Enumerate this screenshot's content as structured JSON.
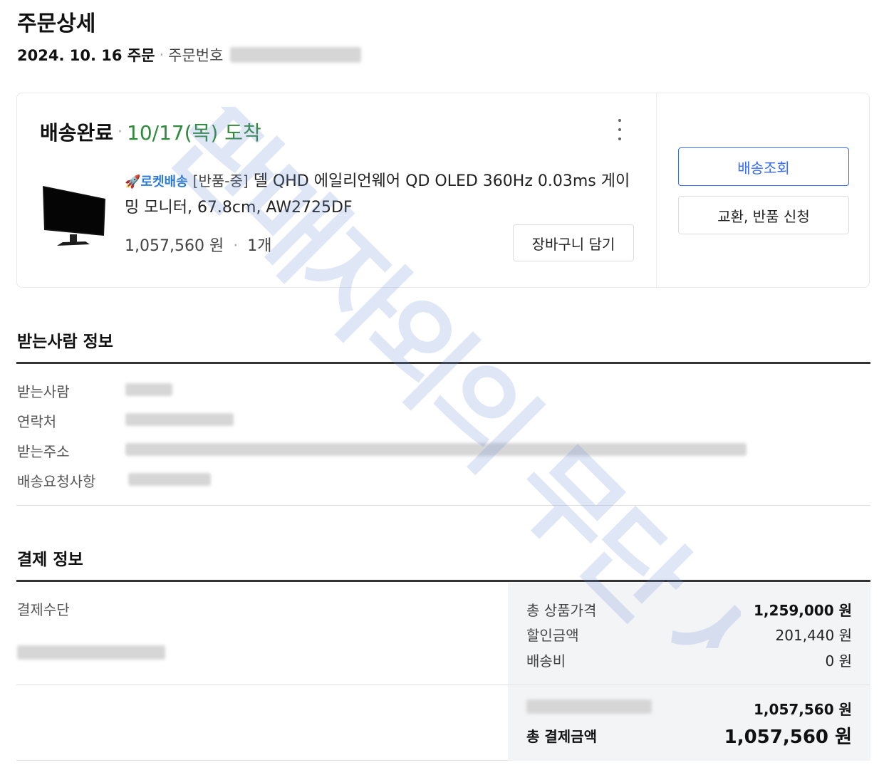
{
  "page": {
    "title": "주문상세"
  },
  "order": {
    "date": "2024. 10. 16 주문",
    "number_label": "주문번호"
  },
  "shipment": {
    "status": "배송완료",
    "arrival": "10/17(목) 도착",
    "badge": "🚀로켓배송",
    "tag": "[반품-중]",
    "product_name": "델 QHD 에일리언웨어 QD OLED 360Hz 0.03ms 게이밍 모니터, 67.8cm, AW2725DF",
    "price": "1,057,560 원",
    "quantity": "1개",
    "cart_button": "장바구니 담기",
    "track_button": "배송조회",
    "return_button": "교환, 반품 신청"
  },
  "receiver": {
    "title": "받는사람 정보",
    "labels": [
      "받는사람",
      "연락처",
      "받는주소",
      "배송요청사항"
    ]
  },
  "payment": {
    "title": "결제 정보",
    "method_label": "결제수단",
    "rows": [
      {
        "label": "총 상품가격",
        "value": "1,259,000 원"
      },
      {
        "label": "할인금액",
        "value": "201,440 원"
      },
      {
        "label": "배송비",
        "value": "0 원"
      }
    ],
    "card_amount": "1,057,560 원",
    "total_label": "총 결제금액",
    "total_value": "1,057,560 원"
  },
  "colors": {
    "accent": "#346aff",
    "arrival_green": "#2e8b3a"
  },
  "watermark": {
    "text": "판매자외의 무단 사용"
  }
}
